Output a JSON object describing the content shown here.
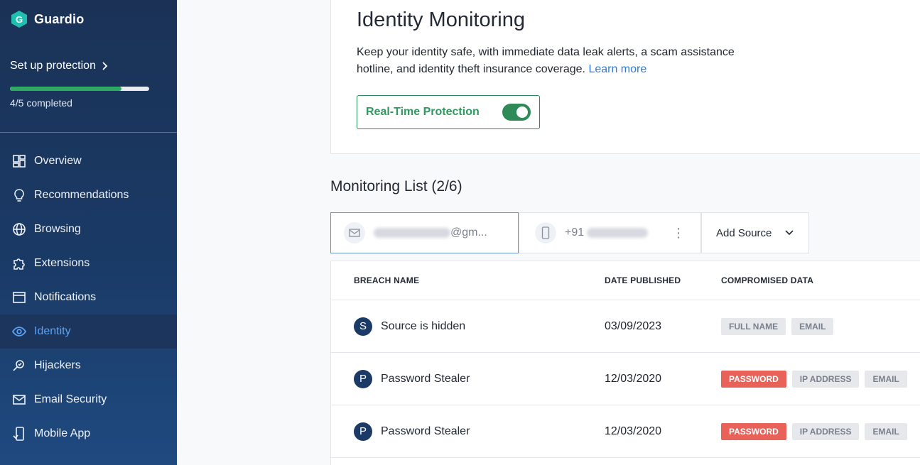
{
  "app": {
    "name": "Guardio"
  },
  "setup": {
    "label": "Set up protection",
    "progress_percent": 80,
    "completed_text": "4/5 completed"
  },
  "nav": [
    {
      "label": "Overview",
      "icon": "grid-icon",
      "active": false
    },
    {
      "label": "Recommendations",
      "icon": "lightbulb-icon",
      "active": false
    },
    {
      "label": "Browsing",
      "icon": "globe-icon",
      "active": false
    },
    {
      "label": "Extensions",
      "icon": "puzzle-icon",
      "active": false
    },
    {
      "label": "Notifications",
      "icon": "window-icon",
      "active": false
    },
    {
      "label": "Identity",
      "icon": "eye-icon",
      "active": true
    },
    {
      "label": "Hijackers",
      "icon": "magnifier-icon",
      "active": false
    },
    {
      "label": "Email Security",
      "icon": "mail-icon",
      "active": false
    },
    {
      "label": "Mobile App",
      "icon": "phone-icon",
      "active": false
    }
  ],
  "identity": {
    "title": "Identity Monitoring",
    "description": "Keep your identity safe, with immediate data leak alerts, a scam assistance hotline, and identity theft insurance coverage.",
    "learn_more": "Learn more",
    "realtime_label": "Real-Time Protection",
    "realtime_on": true
  },
  "monitoring": {
    "title": "Monitoring List (2/6)",
    "sources": [
      {
        "type": "email",
        "visible_text": "@gm..."
      },
      {
        "type": "phone",
        "visible_text": "+91"
      }
    ],
    "add_source": "Add Source"
  },
  "table": {
    "headers": [
      "BREACH NAME",
      "DATE PUBLISHED",
      "COMPROMISED DATA"
    ],
    "rows": [
      {
        "initial": "S",
        "name": "Source is hidden",
        "date": "03/09/2023",
        "tags": [
          {
            "label": "FULL NAME",
            "danger": false
          },
          {
            "label": "EMAIL",
            "danger": false
          }
        ]
      },
      {
        "initial": "P",
        "name": "Password Stealer",
        "date": "12/03/2020",
        "tags": [
          {
            "label": "PASSWORD",
            "danger": true
          },
          {
            "label": "IP ADDRESS",
            "danger": false
          },
          {
            "label": "EMAIL",
            "danger": false
          }
        ]
      },
      {
        "initial": "P",
        "name": "Password Stealer",
        "date": "12/03/2020",
        "tags": [
          {
            "label": "PASSWORD",
            "danger": true
          },
          {
            "label": "IP ADDRESS",
            "danger": false
          },
          {
            "label": "EMAIL",
            "danger": false
          }
        ]
      }
    ]
  },
  "colors": {
    "sidebar": "#1b3256",
    "accent_green": "#2e8b57",
    "link": "#2f7ad8",
    "danger": "#e8625a",
    "active_nav": "#5aa2f5"
  }
}
